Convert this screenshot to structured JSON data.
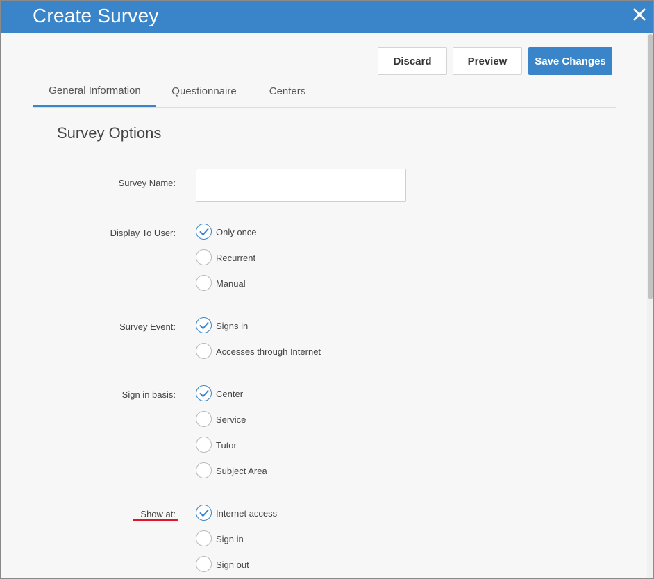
{
  "window": {
    "title": "Create Survey",
    "close_icon": "close-icon"
  },
  "actions": {
    "discard": "Discard",
    "preview": "Preview",
    "save": "Save Changes"
  },
  "tabs": [
    {
      "label": "General Information",
      "active": true
    },
    {
      "label": "Questionnaire",
      "active": false
    },
    {
      "label": "Centers",
      "active": false
    }
  ],
  "section": {
    "title": "Survey Options"
  },
  "fields": {
    "survey_name": {
      "label": "Survey Name:",
      "value": ""
    },
    "display_to_user": {
      "label": "Display To User:",
      "options": [
        {
          "label": "Only once",
          "checked": true
        },
        {
          "label": "Recurrent",
          "checked": false
        },
        {
          "label": "Manual",
          "checked": false
        }
      ]
    },
    "survey_event": {
      "label": "Survey Event:",
      "options": [
        {
          "label": "Signs in",
          "checked": true
        },
        {
          "label": "Accesses through Internet",
          "checked": false
        }
      ]
    },
    "sign_in_basis": {
      "label": "Sign in basis:",
      "options": [
        {
          "label": "Center",
          "checked": true
        },
        {
          "label": "Service",
          "checked": false
        },
        {
          "label": "Tutor",
          "checked": false
        },
        {
          "label": "Subject Area",
          "checked": false
        }
      ]
    },
    "show_at": {
      "label": "Show at:",
      "options": [
        {
          "label": "Internet access",
          "checked": true
        },
        {
          "label": "Sign in",
          "checked": false
        },
        {
          "label": "Sign out",
          "checked": false
        }
      ]
    }
  },
  "colors": {
    "accent": "#3a85c9",
    "annotation_underline": "#e0142a"
  }
}
